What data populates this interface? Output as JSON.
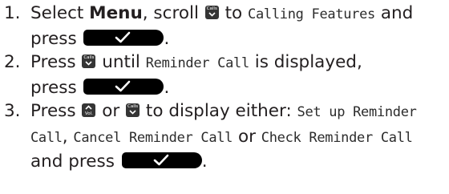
{
  "steps": [
    {
      "number": "1.",
      "line1": {
        "pre": "Select ",
        "key": "Menu",
        "mid": ", scroll ",
        "post": " to ",
        "display": "Calling Features",
        "end": " and"
      },
      "line2": {
        "pre": "press ",
        "end": "."
      }
    },
    {
      "number": "2.",
      "line1": {
        "pre": "Press ",
        "post": " until ",
        "display": "Reminder Call",
        "end": " is displayed,"
      },
      "line2": {
        "pre": "press ",
        "end": "."
      }
    },
    {
      "number": "3.",
      "line1": {
        "pre": "Press ",
        "or": " or ",
        "post": " to display either: ",
        "display": "Set up Reminder"
      },
      "line2": {
        "display1": "Call",
        "sep1": ", ",
        "display2": "Cancel Reminder Call",
        "or": " or ",
        "display3": "Check Reminder Call"
      },
      "line3": {
        "pre": "and press ",
        "end": "."
      }
    }
  ],
  "icons": {
    "calls_label": "Calls",
    "vol_label": "Vol."
  },
  "colors": {
    "text": "#231f20",
    "key_background": "#000000",
    "key_symbol": "#ffffff"
  }
}
